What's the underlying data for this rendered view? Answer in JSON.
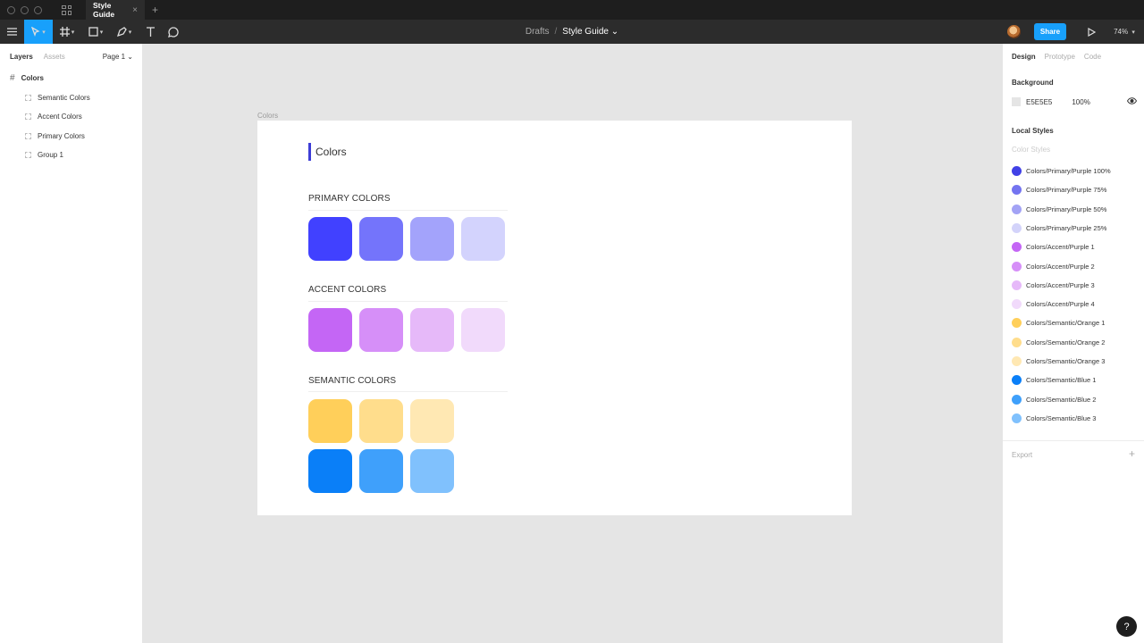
{
  "titlebar": {
    "tab_title": "Style Guide",
    "close": "×",
    "new_tab": "+"
  },
  "toolbar": {
    "breadcrumb_root": "Drafts",
    "separator": "/",
    "file_name": "Style Guide ⌄",
    "share_label": "Share",
    "zoom": "74%",
    "accent_color": "#18a0fb"
  },
  "left_panel": {
    "tab_layers": "Layers",
    "tab_assets": "Assets",
    "page": "Page 1 ⌄",
    "frame_name": "Colors",
    "layers": [
      "Semantic Colors",
      "Accent Colors",
      "Primary Colors",
      "Group 1"
    ]
  },
  "canvas": {
    "frame_label": "Colors",
    "heading": "Colors",
    "sections": {
      "primary": {
        "title": "PRIMARY COLORS",
        "swatches": [
          "#4141ff",
          "#7474fb",
          "#a3a3fb",
          "#d3d3fd"
        ]
      },
      "accent": {
        "title": "ACCENT COLORS",
        "swatches": [
          "#c466f5",
          "#d68ff8",
          "#e6b9f9",
          "#f1dafb"
        ]
      },
      "semantic": {
        "title": "SEMANTIC COLORS",
        "swatches_orange": [
          "#ffcf5a",
          "#ffdd8c",
          "#ffe8b3"
        ],
        "swatches_blue": [
          "#0a7ff8",
          "#3fa0fb",
          "#80c1fd"
        ]
      }
    }
  },
  "right_panel": {
    "tab_design": "Design",
    "tab_prototype": "Prototype",
    "tab_code": "Code",
    "background_title": "Background",
    "background_hex": "E5E5E5",
    "background_opacity": "100%",
    "local_styles_title": "Local Styles",
    "color_styles_label": "Color Styles",
    "styles": [
      {
        "name": "Colors/Primary/Purple 100%",
        "color": "#4141e6"
      },
      {
        "name": "Colors/Primary/Purple 75%",
        "color": "#7474f0"
      },
      {
        "name": "Colors/Primary/Purple 50%",
        "color": "#a3a3f5"
      },
      {
        "name": "Colors/Primary/Purple 25%",
        "color": "#d3d3fa"
      },
      {
        "name": "Colors/Accent/Purple 1",
        "color": "#c466f5"
      },
      {
        "name": "Colors/Accent/Purple 2",
        "color": "#d68ff8"
      },
      {
        "name": "Colors/Accent/Purple 3",
        "color": "#e6b9f9"
      },
      {
        "name": "Colors/Accent/Purple 4",
        "color": "#f1dafb"
      },
      {
        "name": "Colors/Semantic/Orange 1",
        "color": "#ffcf5a"
      },
      {
        "name": "Colors/Semantic/Orange 2",
        "color": "#ffdd8c"
      },
      {
        "name": "Colors/Semantic/Orange 3",
        "color": "#ffe8b3"
      },
      {
        "name": "Colors/Semantic/Blue 1",
        "color": "#0a7ff8"
      },
      {
        "name": "Colors/Semantic/Blue 2",
        "color": "#3fa0fb"
      },
      {
        "name": "Colors/Semantic/Blue 3",
        "color": "#80c1fd"
      }
    ],
    "export_label": "Export",
    "export_add": "+"
  },
  "help": "?"
}
